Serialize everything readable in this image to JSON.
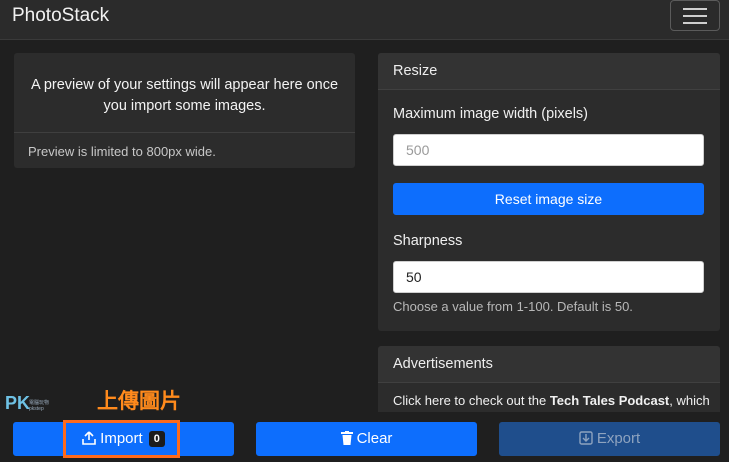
{
  "app": {
    "title": "PhotoStack"
  },
  "preview": {
    "message_line1": "A preview of your settings will appear here once",
    "message_line2": "you import some images.",
    "footer": "Preview is limited to 800px wide."
  },
  "resize": {
    "header": "Resize",
    "width_label": "Maximum image width (pixels)",
    "width_placeholder": "500",
    "reset_button": "Reset image size",
    "sharpness_label": "Sharpness",
    "sharpness_value": "50",
    "sharpness_help": "Choose a value from 1-100. Default is 50."
  },
  "ads": {
    "header": "Advertisements",
    "text_prefix": "Click here to check out the ",
    "text_bold": "Tech Tales Podcast",
    "text_suffix": ", which"
  },
  "watermark": {
    "logo": "PK",
    "sub1": "電腦玩物",
    "sub2": "pkstep"
  },
  "annotation": "上傳圖片",
  "toolbar": {
    "import_label": "Import",
    "import_count": "0",
    "clear_label": "Clear",
    "export_label": "Export"
  },
  "icons": {
    "menu": "hamburger-icon",
    "import": "upload-icon",
    "clear": "trash-icon",
    "export": "download-icon"
  },
  "colors": {
    "primary": "#0d6efd",
    "annotation": "#ff6a1a"
  }
}
